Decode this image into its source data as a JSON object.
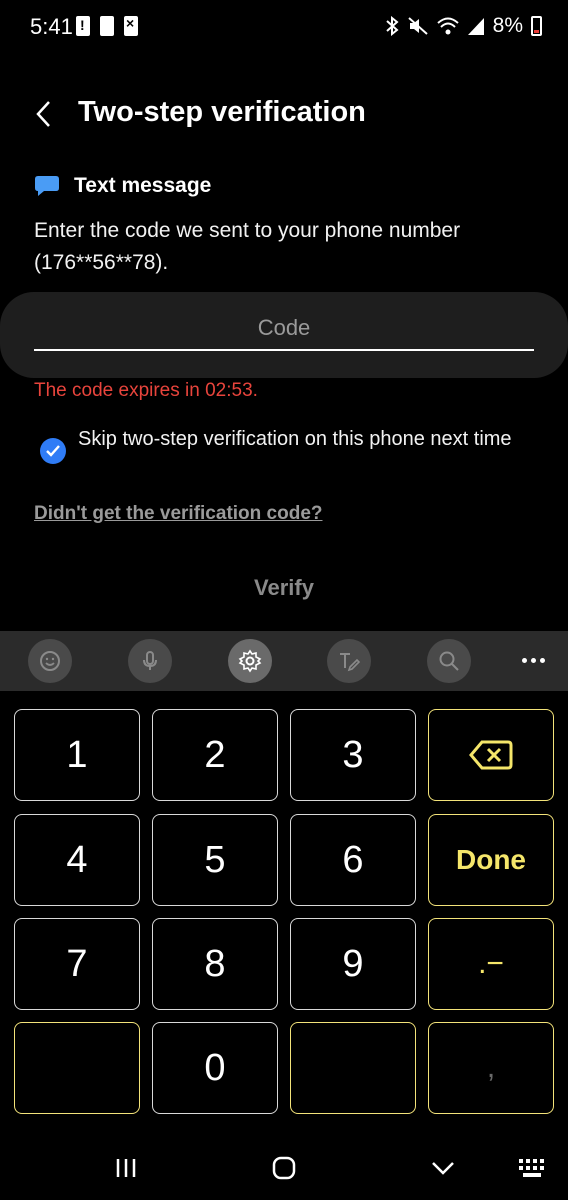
{
  "status_bar": {
    "time": "5:41",
    "battery": "8%",
    "icons": [
      "bluetooth-icon",
      "mute-icon",
      "wifi-icon",
      "signal-icon",
      "battery-icon"
    ]
  },
  "header": {
    "title": "Two-step verification",
    "back_icon": "chevron-left-icon"
  },
  "method": {
    "icon": "chat-bubble-icon",
    "label": "Text message"
  },
  "instruction": "Enter the code we sent to your phone number (176**56**78).",
  "code_field": {
    "placeholder": "Code",
    "value": ""
  },
  "expire_text": "The code expires in 02:53.",
  "skip": {
    "label": "Skip two-step verification on this phone next time",
    "checked": true
  },
  "resend_link": "Didn't get the verification code?",
  "verify_label": "Verify",
  "keyboard": {
    "toolbar": [
      "emoji-icon",
      "mic-icon",
      "settings-icon",
      "handwriting-icon",
      "search-icon",
      "more-icon"
    ],
    "keys": {
      "k1": "1",
      "k2": "2",
      "k3": "3",
      "k4": "4",
      "k5": "5",
      "k6": "6",
      "k7": "7",
      "k8": "8",
      "k9": "9",
      "k0": "0",
      "done": "Done",
      "dotdash": ".−",
      "comma": ","
    }
  },
  "colors": {
    "background": "#000000",
    "accent_blue": "#2f7cf6",
    "error_red": "#e8443c",
    "key_yellow": "#f5e66a"
  }
}
